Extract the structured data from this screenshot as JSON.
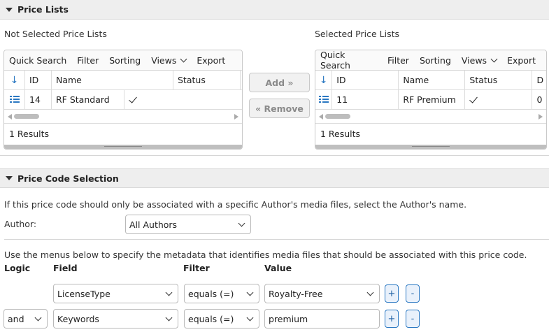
{
  "price_lists": {
    "section_title": "Price Lists",
    "not_selected": {
      "label": "Not Selected Price Lists",
      "toolbar": [
        "Quick Search",
        "Filter",
        "Sorting",
        "Views",
        "Export"
      ],
      "columns": [
        "ID",
        "Name",
        "Status"
      ],
      "rows": [
        {
          "id": "14",
          "name": "RF Standard",
          "status_checked": true
        }
      ],
      "results": "1 Results"
    },
    "selected": {
      "label": "Selected Price Lists",
      "toolbar": [
        "Quick Search",
        "Filter",
        "Sorting",
        "Views",
        "Export"
      ],
      "columns": [
        "ID",
        "Name",
        "Status",
        "D"
      ],
      "rows": [
        {
          "id": "11",
          "name": "RF Premium",
          "status_checked": true,
          "extra": "0"
        }
      ],
      "results": "1 Results"
    },
    "add_label": "Add »",
    "remove_label": "« Remove"
  },
  "price_code": {
    "section_title": "Price Code Selection",
    "author_help": "If this price code should only be associated with a specific Author's media files, select the Author's name.",
    "author_label": "Author:",
    "author_value": "All Authors",
    "metadata_help": "Use the menus below to specify the metadata that identifies media files that should be associated with this price code.",
    "headers": {
      "logic": "Logic",
      "field": "Field",
      "filter": "Filter",
      "value": "Value"
    },
    "rules": [
      {
        "logic": "",
        "field": "LicenseType",
        "filter": "equals (=)",
        "value": "Royalty-Free",
        "value_is_select": true
      },
      {
        "logic": "and",
        "field": "Keywords",
        "filter": "equals (=)",
        "value": "premium",
        "value_is_select": false
      }
    ],
    "plus_label": "+",
    "minus_label": "-"
  }
}
